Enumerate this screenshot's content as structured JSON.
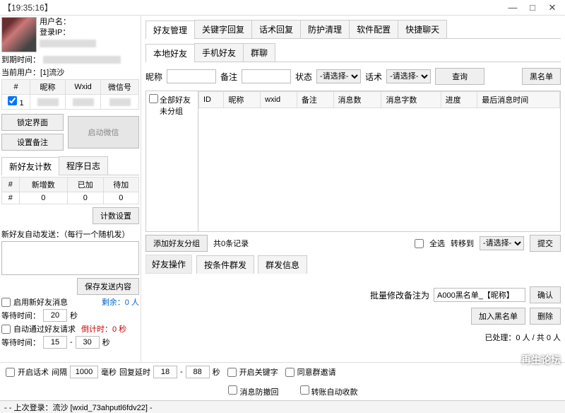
{
  "window": {
    "title": "【19:35:16】",
    "min": "—",
    "max": "□",
    "close": "✕"
  },
  "left": {
    "user_label": "用户名：",
    "ip_label": "登录IP：",
    "expire_label": "到期时间：",
    "current_user": "当前用户：[1]流沙",
    "acct_table": {
      "cols": [
        "#",
        "昵称",
        "Wxid",
        "微信号"
      ],
      "row": [
        "1",
        "",
        "",
        ""
      ]
    },
    "btn_lock": "锁定界面",
    "btn_remark": "设置备注",
    "btn_startwx": "启动微信",
    "tabs_count": "新好友计数",
    "tabs_log": "程序日志",
    "count_cols": [
      "#",
      "新增数",
      "已加",
      "待加"
    ],
    "count_row": [
      "#",
      "0",
      "0",
      "0"
    ],
    "btn_count_set": "计数设置",
    "autosend_title": "新好友自动发送：（每行一个随机发）",
    "btn_save_send": "保存发送内容",
    "chk_enable_newmsg": "启用新好友消息",
    "remain": "剩余：0 人",
    "wait_label": "等待时间：",
    "wait_val": "20",
    "sec": "秒",
    "chk_autopass": "自动通过好友请求",
    "countdown": "倒计时：0 秒",
    "wait2a": "15",
    "wait2b": "30"
  },
  "tabs": [
    "好友管理",
    "关键字回复",
    "话术回复",
    "防护清理",
    "软件配置",
    "快捷聊天"
  ],
  "subtabs": [
    "本地好友",
    "手机好友",
    "群聊"
  ],
  "filter": {
    "nick": "昵称",
    "remark": "备注",
    "status": "状态",
    "status_ph": "-请选择-",
    "script": "话术",
    "script_ph": "-请选择-",
    "query": "查询",
    "blacklist": "黑名单"
  },
  "tree": {
    "all": "全部好友",
    "ungrouped": "未分组"
  },
  "cols": [
    "ID",
    "昵称",
    "wxid",
    "备注",
    "消息数",
    "消息字数",
    "进度",
    "最后消息时间"
  ],
  "below": {
    "add_group": "添加好友分组",
    "total": "共0条记录",
    "selectall": "全选",
    "moveto": "转移到",
    "moveto_ph": "-请选择-",
    "submit": "提交"
  },
  "ops": {
    "label": "好友操作",
    "t1": "按条件群发",
    "t2": "群发信息"
  },
  "batch": {
    "label": "批量修改备注为",
    "value": "A000黑名单_【昵称】",
    "confirm": "确认",
    "addbl": "加入黑名单",
    "delete": "删除"
  },
  "processed": "已处理：0 人 / 共 0 人",
  "footer": {
    "chk_script": "开启话术",
    "interval": "间隔",
    "interval_v": "1000",
    "ms": "毫秒",
    "reply_delay": "回复延时",
    "d1": "18",
    "d2": "88",
    "sec": "秒",
    "chk_keyword": "开启关键字",
    "chk_agree": "同意群邀请",
    "chk_antirecall": "消息防撤回",
    "chk_autocollect": "转账自动收款"
  },
  "status": "- - 上次登录：流沙 [wxid_73ahputl6fdv22] -",
  "watermark": "再生论坛"
}
